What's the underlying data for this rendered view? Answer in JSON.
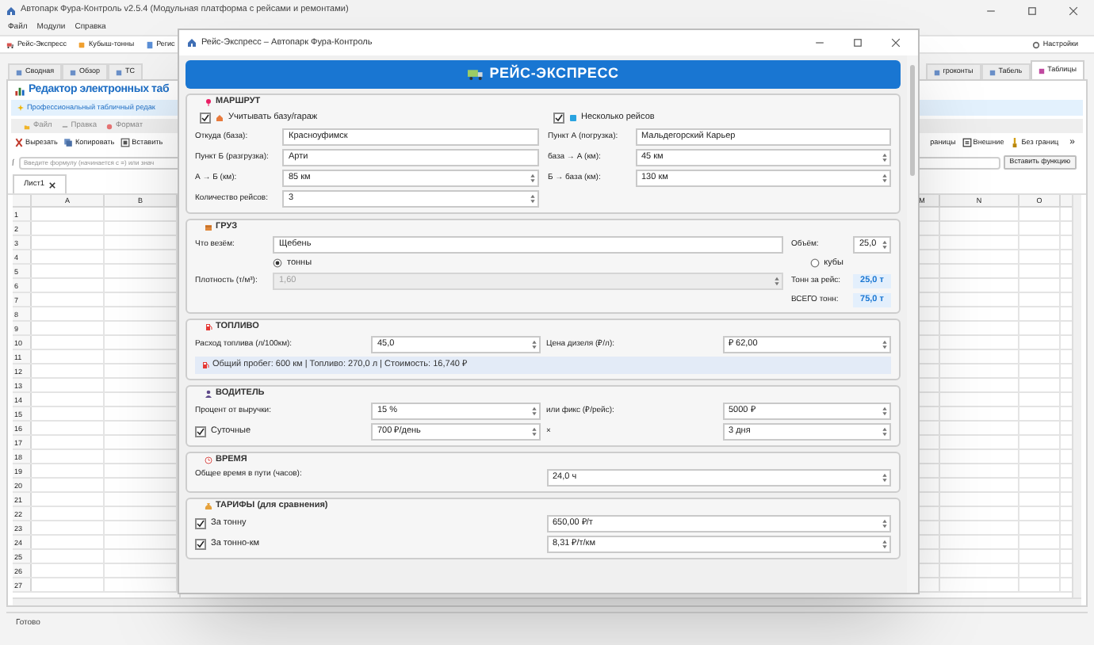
{
  "app": {
    "title": "Автопарк Фура-Контроль v2.5.4 (Модульная платформа с рейсами и ремонтами)",
    "menu": [
      "Файл",
      "Модули",
      "Справка"
    ],
    "toolbar": [
      "Рейс-Экспресс",
      "Кубыш-тонны",
      "Регис"
    ],
    "settings": "Настройки",
    "tabs_left": [
      {
        "label": "Сводная",
        "selected": false
      },
      {
        "label": "Обзор",
        "selected": false
      },
      {
        "label": "ТС",
        "selected": false
      }
    ],
    "tabs_right": [
      {
        "label": "гроконты",
        "selected": false
      },
      {
        "label": "Табель",
        "selected": false
      },
      {
        "label": "Таблицы",
        "selected": true
      }
    ],
    "editor": {
      "title": "Редактор электронных таб",
      "subtitle": "Профессиональный табличный редак",
      "menu": [
        "Файл",
        "Правка",
        "Формат"
      ],
      "tools_left": [
        "Вырезать",
        "Копировать",
        "Вставить"
      ],
      "tools_right": [
        "раницы",
        "Внешние",
        "Без границ"
      ],
      "more": "»",
      "formula_placeholder": "Введите формулу (начинается с =) или знач",
      "insert_function": "Вставить функцию",
      "sheet_tab": "Лист1",
      "columns_left": [
        "A",
        "B"
      ],
      "columns_right": [
        "M",
        "N",
        "O"
      ],
      "rows": [
        "1",
        "2",
        "3",
        "4",
        "5",
        "6",
        "7",
        "8",
        "9",
        "10",
        "11",
        "12",
        "13",
        "14",
        "15",
        "16",
        "17",
        "18",
        "19",
        "20",
        "21",
        "22",
        "23",
        "24",
        "25",
        "26",
        "27"
      ]
    },
    "status": "Готово"
  },
  "dialog": {
    "title": "Рейс-Экспресс – Автопарк Фура-Контроль",
    "banner": "РЕЙС-ЭКСПРЕСС",
    "route": {
      "title": "МАРШРУТ",
      "checks": [
        {
          "label": "Учитывать базу/гараж",
          "checked": true
        },
        {
          "label": "Несколько рейсов",
          "checked": true
        }
      ],
      "left": [
        {
          "label": "Откуда (база):",
          "value": "Красноуфимск",
          "kind": "text"
        },
        {
          "label": "Пункт Б (разгрузка):",
          "value": "Арти",
          "kind": "text"
        },
        {
          "label": "А → Б (км):",
          "value": "85 км",
          "kind": "spin"
        },
        {
          "label": "Количество рейсов:",
          "value": "3",
          "kind": "spin"
        }
      ],
      "right": [
        {
          "label": "Пункт А (погрузка):",
          "value": "Мальдегорский Карьер",
          "kind": "text"
        },
        {
          "label": "база → А (км):",
          "value": "45 км",
          "kind": "spin"
        },
        {
          "label": "Б → база (км):",
          "value": "130 км",
          "kind": "spin"
        }
      ]
    },
    "cargo": {
      "title": "ГРУЗ",
      "what": {
        "label": "Что везём:",
        "value": "Щебень"
      },
      "volume": {
        "label": "Объём:",
        "value": "25,0"
      },
      "units": [
        {
          "label": "тонны",
          "selected": true
        },
        {
          "label": "кубы",
          "selected": false
        }
      ],
      "density": {
        "label": "Плотность (т/м³):",
        "value": "1,60",
        "disabled": true
      },
      "per_trip": {
        "label": "Тонн за рейс:",
        "value": "25,0 т"
      },
      "total": {
        "label": "ВСЕГО тонн:",
        "value": "75,0 т"
      }
    },
    "fuel": {
      "title": "ТОПЛИВО",
      "fields": [
        {
          "label": "Расход топлива (л/100км):",
          "value": "45,0"
        },
        {
          "label": "Цена дизеля (₽/л):",
          "value": "₽ 62,00"
        }
      ],
      "summary": "Общий пробег: 600 км | Топливо: 270,0 л | Стоимость: 16,740 ₽"
    },
    "driver": {
      "title": "ВОДИТЕЛЬ",
      "percent": {
        "label": "Процент от выручки:",
        "value": "15 %"
      },
      "fixed": {
        "label": "или фикс (₽/рейс):",
        "value": "5000 ₽"
      },
      "per_diem": {
        "label": "Суточные",
        "checked": true,
        "value": "700 ₽/день"
      },
      "times": "×",
      "days": "3 дня"
    },
    "time": {
      "title": "ВРЕМЯ",
      "label": "Общее время в пути (часов):",
      "value": "24,0 ч"
    },
    "tariffs": {
      "title": "ТАРИФЫ (для сравнения)",
      "items": [
        {
          "label": "За тонну",
          "checked": true,
          "value": "650,00 ₽/т"
        },
        {
          "label": "За тонно-км",
          "checked": true,
          "value": "8,31 ₽/т/км"
        }
      ]
    }
  }
}
